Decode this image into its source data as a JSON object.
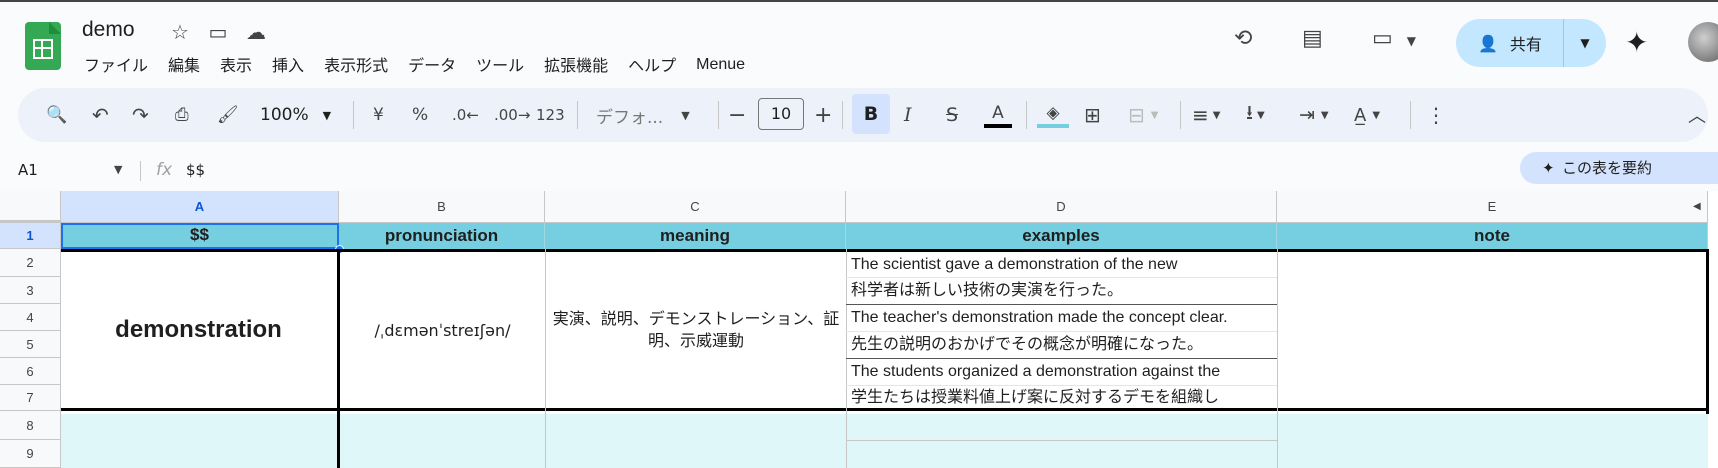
{
  "app": {
    "title": "demo"
  },
  "menu": [
    "ファイル",
    "編集",
    "表示",
    "挿入",
    "表示形式",
    "データ",
    "ツール",
    "拡張機能",
    "ヘルプ",
    "Menue"
  ],
  "share": {
    "label": "共有"
  },
  "toolbar": {
    "zoom": "100%",
    "currency": "¥",
    "percent": "%",
    "dec_minus": ".0",
    "dec_plus": ".00",
    "numfmt": "123",
    "font": "デフォ...",
    "font_size": "10",
    "bold": "B",
    "italic": "I"
  },
  "formula": {
    "name_box": "A1",
    "fx": "fx",
    "value": "$$"
  },
  "summarize": {
    "label": "この表を要約"
  },
  "columns": [
    "A",
    "B",
    "C",
    "D",
    "E"
  ],
  "rows": [
    "1",
    "2",
    "3",
    "4",
    "5",
    "6",
    "7",
    "8",
    "9"
  ],
  "header_row": {
    "a": "$$",
    "b": "pronunciation",
    "c": "meaning",
    "d": "examples",
    "e": "note"
  },
  "entry": {
    "word": "demonstration",
    "pronunciation": "/ˌdɛmənˈstreɪʃən/",
    "meaning": "実演、説明、デモンストレーション、証明、示威運動",
    "examples": [
      "The scientist gave a demonstration of the new",
      "科学者は新しい技術の実演を行った。",
      "The teacher's demonstration made the concept clear.",
      "先生の説明のおかげでその概念が明確になった。",
      "The students organized a demonstration against the",
      "学生たちは授業料値上げ案に反対するデモを組織し"
    ]
  },
  "colors": {
    "header_fill": "#76cfe0",
    "empty_fill": "#e0f7fa",
    "share_bg": "#c2e7ff",
    "accent": "#0b57d0"
  }
}
